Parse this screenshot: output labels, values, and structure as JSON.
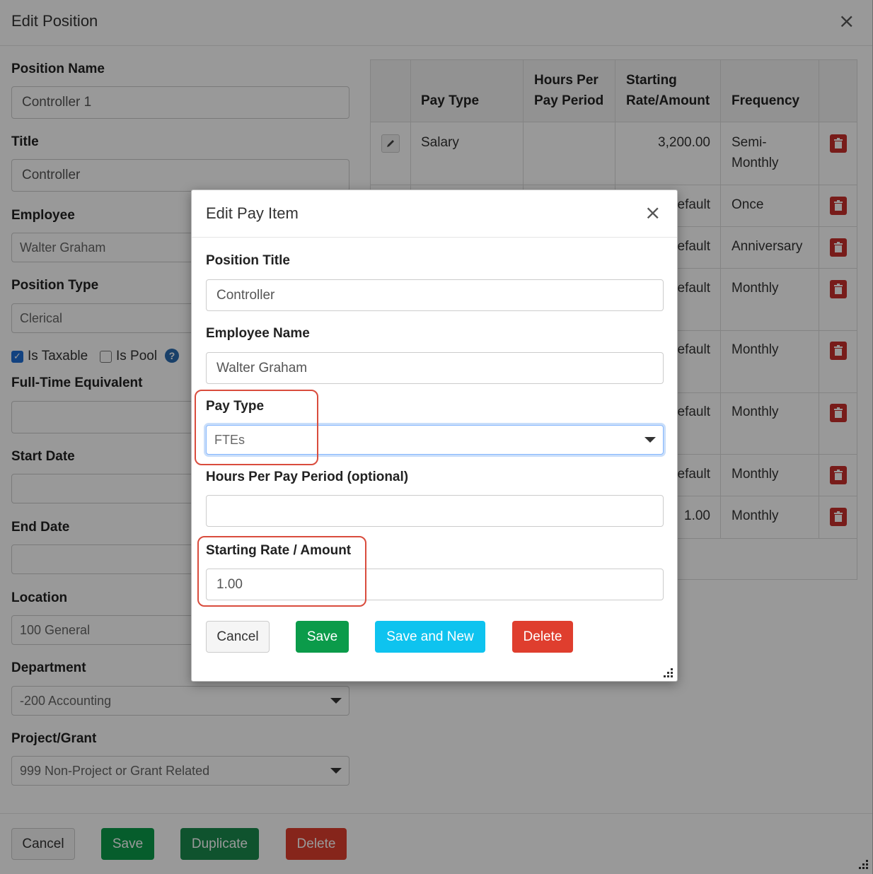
{
  "outer": {
    "title": "Edit Position",
    "close_glyph": "×",
    "position_name_label": "Position Name",
    "position_name_value": "Controller 1",
    "title_label": "Title",
    "title_value": "Controller",
    "employee_label": "Employee",
    "employee_value": "Walter Graham",
    "position_type_label": "Position Type",
    "position_type_value": "Clerical",
    "is_taxable_label": "Is Taxable",
    "is_taxable_checked": true,
    "is_pool_label": "Is Pool",
    "is_pool_checked": false,
    "help_glyph": "?",
    "fte_label": "Full-Time Equivalent",
    "fte_value": "",
    "start_date_label": "Start Date",
    "start_date_value": "",
    "end_date_label": "End Date",
    "end_date_value": "",
    "location_label": "Location",
    "location_value": "100 General",
    "department_label": "Department",
    "department_value": "-200 Accounting",
    "project_label": "Project/Grant",
    "project_value": "999 Non-Project or Grant Related",
    "footer": {
      "cancel": "Cancel",
      "save": "Save",
      "duplicate": "Duplicate",
      "delete": "Delete"
    }
  },
  "table": {
    "headers": {
      "pay_type": "Pay Type",
      "hours_l1": "Hours Per",
      "hours_l2": "Pay Period",
      "rate_l1": "Starting",
      "rate_l2": "Rate/Amount",
      "frequency": "Frequency"
    },
    "rows": [
      {
        "pay_type": "Salary",
        "rate": "3,200.00",
        "freq_l1": "Semi-",
        "freq_l2": "Monthly"
      },
      {
        "rate": "efault",
        "freq_l1": "Once"
      },
      {
        "rate": "efault",
        "freq_l1": "Anniversary"
      },
      {
        "rate": "efault",
        "freq_l1": "Monthly"
      },
      {
        "rate": "efault",
        "freq_l1": "Monthly"
      },
      {
        "rate": "efault",
        "freq_l1": "Monthly"
      },
      {
        "rate": "efault",
        "freq_l1": "Monthly"
      },
      {
        "rate": "1.00",
        "freq_l1": "Monthly"
      }
    ]
  },
  "modal": {
    "title": "Edit Pay Item",
    "close_glyph": "×",
    "position_title_label": "Position Title",
    "position_title_value": "Controller",
    "employee_name_label": "Employee Name",
    "employee_name_value": "Walter Graham",
    "pay_type_label": "Pay Type",
    "pay_type_value": "FTEs",
    "hours_label": "Hours Per Pay Period (optional)",
    "hours_value": "",
    "rate_label": "Starting Rate / Amount",
    "rate_value": "1.00",
    "buttons": {
      "cancel": "Cancel",
      "save": "Save",
      "save_new": "Save and New",
      "delete": "Delete"
    }
  },
  "colors": {
    "highlight": "#d94c3d",
    "save_green": "#0b9b4a",
    "cyan": "#0ec3ef",
    "danger_red": "#df3e2e",
    "trash_red": "#c9302c"
  }
}
